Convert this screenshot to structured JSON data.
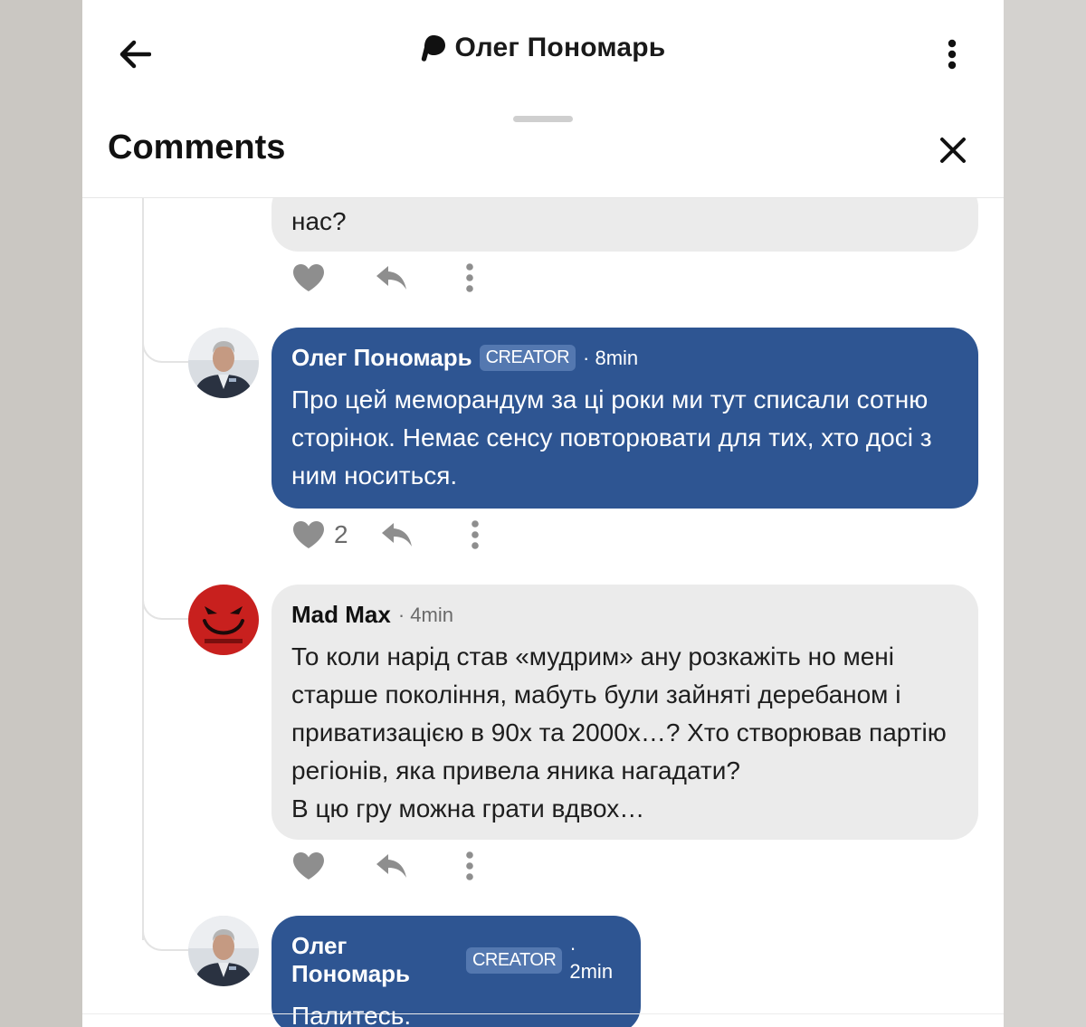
{
  "header": {
    "title": "Олег Пономарь",
    "back_icon": "arrow-left-icon",
    "brand_icon": "patreon-logo-icon",
    "more_icon": "more-vertical-icon"
  },
  "sheet": {
    "title": "Comments",
    "close_icon": "close-icon"
  },
  "colors": {
    "creator_bubble": "#2e5592",
    "user_bubble": "#ebebeb",
    "badge": "#5478b0"
  },
  "comments": [
    {
      "partial": true,
      "text": "нас?",
      "likes": ""
    },
    {
      "author": "Олег Пономарь",
      "badge": "CREATOR",
      "time": "· 8min",
      "text": "Про цей меморандум за ці роки ми тут списали сотню сторінок. Немає сенсу повторювати для тих, хто досі з ним носиться.",
      "likes": "2"
    },
    {
      "author": "Mad Max",
      "badge": "",
      "time": "· 4min",
      "text": "То коли нарід став «мудрим» ану розкажіть но мені старше покоління, мабуть були зайняті деребаном і приватизацією в 90х та 2000х…? Хто створював партію регіонів, яка привела яника нагадати?\nВ цю гру можна грати вдвох…",
      "likes": ""
    },
    {
      "author": "Олег Пономарь",
      "badge": "CREATOR",
      "time": "· 2min",
      "text": "Палитесь.",
      "likes": ""
    }
  ]
}
